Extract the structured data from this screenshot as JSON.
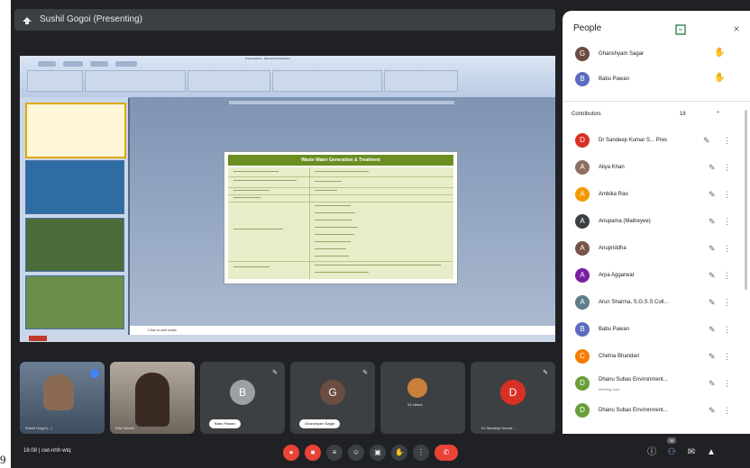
{
  "page_number": "9",
  "presenter_bar": {
    "title": "Sushil Gogoi (Presenting)"
  },
  "presentation": {
    "window_title": "Presentation1 - Microsoft PowerPoint",
    "slide_title": "Waste Water Generation & Treatment",
    "notes_placeholder": "Click to add notes"
  },
  "people_panel": {
    "title": "People",
    "hosts": [
      {
        "name": "Ghanshyam Sagar",
        "initial": "G",
        "color": "#6d4c41"
      },
      {
        "name": "Babu Pawan",
        "initial": "B",
        "color": "#5c6bc0"
      }
    ],
    "section_label": "Contributors",
    "section_count": "18",
    "contributors": [
      {
        "name": "Dr Sandeep Kumar S...",
        "tag": "Pres",
        "initial": "D",
        "color": "#d93025"
      },
      {
        "name": "Aliya Khan",
        "initial": "A",
        "color": "#8d6e63"
      },
      {
        "name": "Ambika Rao",
        "initial": "A",
        "color": "#f29900"
      },
      {
        "name": "Anupama (Maitreyee)",
        "initial": "A",
        "color": "#3c4043"
      },
      {
        "name": "Anupriddha",
        "initial": "A",
        "color": "#795548"
      },
      {
        "name": "Arpa Aggarwal",
        "initial": "A",
        "color": "#7b1fa2"
      },
      {
        "name": "Arun Sharma, S.G.S.S Coll...",
        "initial": "A",
        "color": "#607d8b"
      },
      {
        "name": "Babu Pawan",
        "initial": "B",
        "color": "#5c6bc0"
      },
      {
        "name": "Chetna Bhandari",
        "initial": "C",
        "color": "#f57c00"
      },
      {
        "name": "Dhanu Subas Environment...",
        "sub": "Meeting host",
        "initial": "D",
        "color": "#689f38"
      },
      {
        "name": "Dhanu Subas Environment...",
        "initial": "D",
        "color": "#689f38"
      }
    ]
  },
  "tiles": [
    {
      "name": "Sushil Gogoi (...)"
    },
    {
      "name": "Rita Sahani"
    },
    {
      "name": "Babu Pawan",
      "initial": "B"
    },
    {
      "name": "Ghanshyam Sagar",
      "initial": "G"
    },
    {
      "name": "24 others"
    },
    {
      "name": "Dr Sandeep Kumar ...",
      "initial": "D"
    }
  ],
  "bottom_bar": {
    "time_code": "16:08  |  cwt-nhfr-wtq",
    "participants_badge": "35"
  },
  "colors": {
    "end_call": "#ea4335",
    "meet_bg": "#202124",
    "slide_header": "#6b8e23"
  }
}
